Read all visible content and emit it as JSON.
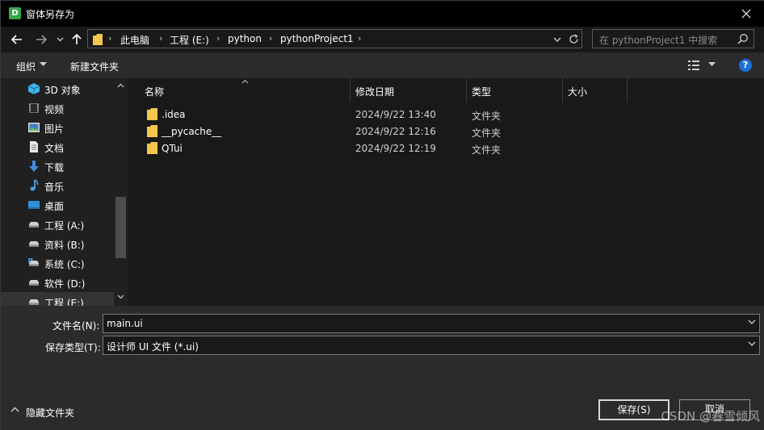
{
  "window": {
    "app_icon_letter": "D",
    "title": "窗体另存为"
  },
  "address": {
    "breadcrumbs": [
      "此电脑",
      "工程 (E:)",
      "python",
      "pythonProject1"
    ],
    "search_placeholder": "在 pythonProject1 中搜索"
  },
  "toolbar": {
    "organize_label": "组织",
    "new_folder_label": "新建文件夹",
    "help_label": "?"
  },
  "nav_pane": {
    "items": [
      {
        "label": "3D 对象",
        "icon": "3d-objects-icon"
      },
      {
        "label": "视频",
        "icon": "videos-icon"
      },
      {
        "label": "图片",
        "icon": "pictures-icon"
      },
      {
        "label": "文档",
        "icon": "documents-icon"
      },
      {
        "label": "下载",
        "icon": "downloads-icon"
      },
      {
        "label": "音乐",
        "icon": "music-icon"
      },
      {
        "label": "桌面",
        "icon": "desktop-icon"
      },
      {
        "label": "工程 (A:)",
        "icon": "drive-icon"
      },
      {
        "label": "资料 (B:)",
        "icon": "drive-icon"
      },
      {
        "label": "系统 (C:)",
        "icon": "system-drive-icon"
      },
      {
        "label": "软件 (D:)",
        "icon": "drive-icon"
      },
      {
        "label": "工程 (E:)",
        "icon": "drive-icon"
      }
    ]
  },
  "file_list": {
    "columns": [
      "名称",
      "修改日期",
      "类型",
      "大小"
    ],
    "rows": [
      {
        "name": ".idea",
        "modified": "2024/9/22 13:40",
        "type": "文件夹"
      },
      {
        "name": "__pycache__",
        "modified": "2024/9/22 12:16",
        "type": "文件夹"
      },
      {
        "name": "QTui",
        "modified": "2024/9/22 12:19",
        "type": "文件夹"
      }
    ]
  },
  "form": {
    "filename_label": "文件名(N):",
    "filename_value": "main.ui",
    "filetype_label": "保存类型(T):",
    "filetype_value": "设计师 UI 文件 (*.ui)"
  },
  "footer": {
    "hide_folders_label": "隐藏文件夹",
    "save_label": "保存(S)",
    "cancel_label": "取消",
    "watermark": "CSDN @春雪倾风"
  },
  "colors": {
    "background": "#191919",
    "titlebar": "#000000",
    "toolbar": "#2b2b2b",
    "folder": "#f3c74c",
    "accent": "#1e6fd9"
  }
}
